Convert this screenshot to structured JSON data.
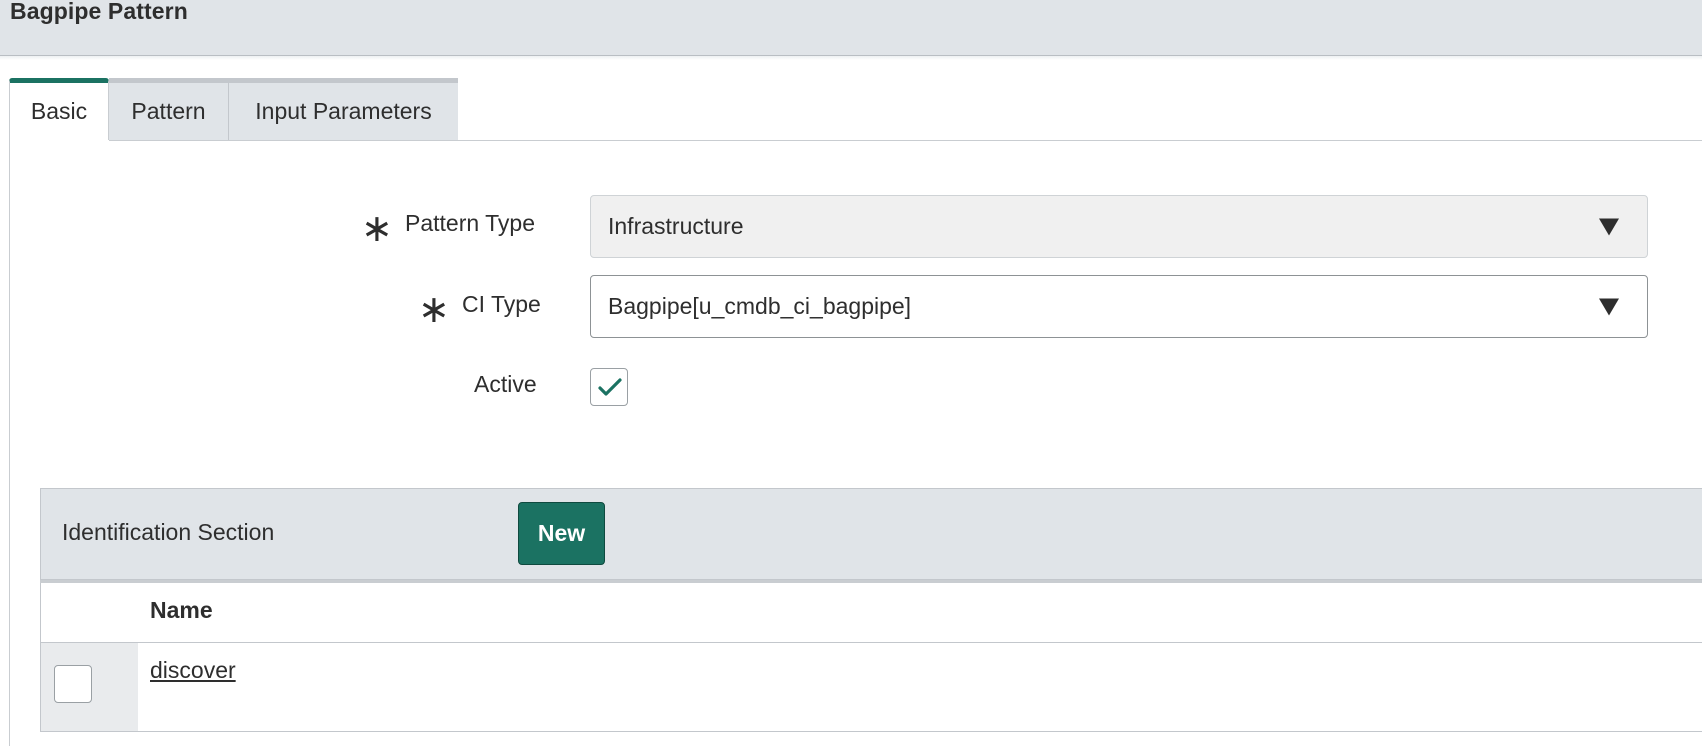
{
  "header": {
    "title": "Bagpipe Pattern"
  },
  "tabs": [
    {
      "label": "Basic",
      "active": true
    },
    {
      "label": "Pattern",
      "active": false
    },
    {
      "label": "Input Parameters",
      "active": false
    }
  ],
  "form": {
    "required_marker": "∗",
    "pattern_type": {
      "label": "Pattern Type",
      "value": "Infrastructure"
    },
    "ci_type": {
      "label": "CI Type",
      "value": "Bagpipe[u_cmdb_ci_bagpipe]"
    },
    "active": {
      "label": "Active",
      "checked": true
    }
  },
  "identification": {
    "title": "Identification Section",
    "new_label": "New",
    "columns": [
      "Name"
    ],
    "rows": [
      {
        "name": "discover"
      }
    ]
  },
  "colors": {
    "accent": "#1b7262",
    "header_bg": "#e0e4e8"
  },
  "icons": {
    "dropdown": "caret-down-icon",
    "check": "checkmark-icon"
  }
}
